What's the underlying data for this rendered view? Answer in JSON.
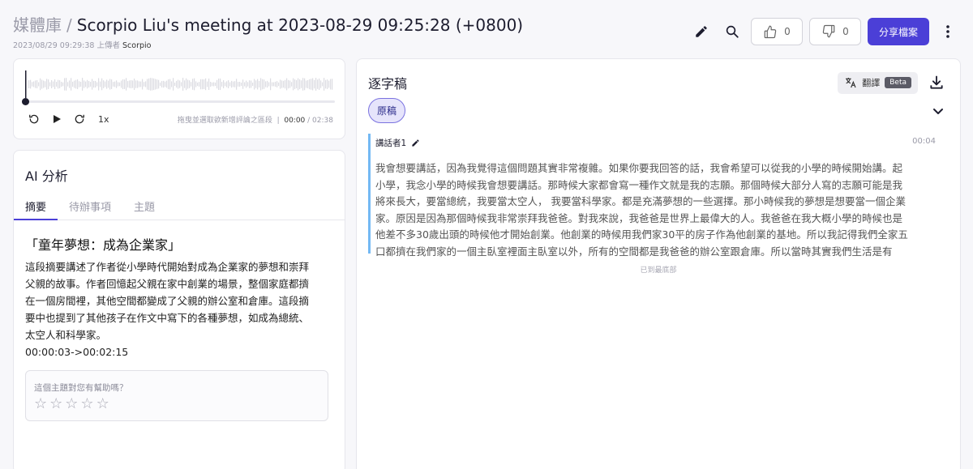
{
  "header": {
    "breadcrumb_root": "媒體庫",
    "separator": "/",
    "title": "Scorpio Liu's meeting at 2023-08-29 09:25:28 (+0800)",
    "upload_datetime": "2023/08/29 09:29:38",
    "upload_label": "上傳者",
    "uploader": "Scorpio",
    "like_count": "0",
    "dislike_count": "0",
    "share_label": "分享檔案",
    "icons": [
      "pencil-icon",
      "search-icon",
      "thumbs-up-icon",
      "thumbs-down-icon",
      "more-vertical-icon"
    ]
  },
  "player": {
    "speed": "1x",
    "hint": "拖曳並選取欲新增評論之區段",
    "separator": "|",
    "current_time": "00:00",
    "total_time": "/ 02:38",
    "progress_fraction": 0,
    "icons": [
      "rewind-icon",
      "play-icon",
      "forward-icon"
    ]
  },
  "ai": {
    "title": "AI 分析",
    "tabs": [
      "摘要",
      "待辦事項",
      "主題"
    ],
    "active_tab": "摘要",
    "summary_title": "「童年夢想：成為企業家」",
    "summary_lines": [
      "這段摘要講述了作者從小學時代開始對成為企業家的夢想和崇拜",
      "父親的故事。作者回憶起父親在家中創業的場景，整個家庭都擠",
      "在一個房間裡，其他空間都變成了父親的辦公室和倉庫。這段摘",
      "要中也提到了其他孩子在作文中寫下的各種夢想，如成為總統、",
      "太空人和科學家。",
      "00:00:03->00:02:15"
    ],
    "feedback_question": "這個主題對您有幫助嗎？",
    "rating": 0,
    "rating_max": 5
  },
  "transcript": {
    "title": "逐字稿",
    "translate_label": "翻譯",
    "beta_label": "Beta",
    "version_chip": "原稿",
    "segments": [
      {
        "speaker": "講話者1",
        "time": "00:04",
        "lines": [
          "我會想要講話，因為我覺得這個問題其實非常複雜。如果你要我回答的話，我會希望可以從我的小學的時候開始講。起",
          "小學，我念小學的時候我會想要講話。那時候大家都會寫一種作文就是我的志願。那個時候大部分人寫的志願可能是我",
          "將來長大，要當總統，我要當太空人， 我要當科學家。都是充滿夢想的一些選擇。那小時候我的夢想是想要當一個企業",
          "家。原因是因為那個時候我非常崇拜我爸爸。對我來說，我爸爸是世界上最偉大的人。我爸爸在我大概小學的時候也是",
          "他差不多30歲出頭的時候他才開始創業。他創業的時候用我們家30平的房子作為他創業的基地。所以我記得我們全家五",
          "口都擠在我們家的一個主臥室裡面主臥室以外，所有的空間都是我爸爸的辦公室跟倉庫。所以當時其實我們生活是有"
        ]
      }
    ],
    "end_note": "已到最底部"
  }
}
